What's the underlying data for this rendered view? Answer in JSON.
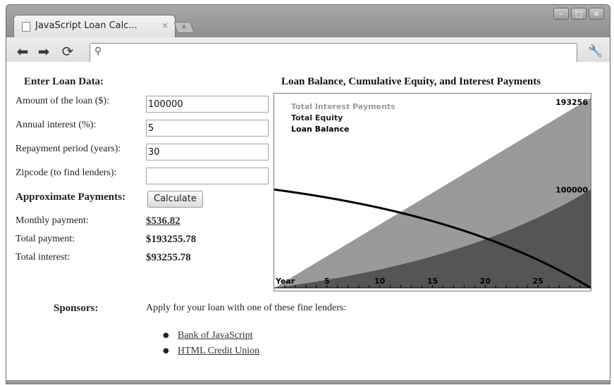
{
  "browser": {
    "tab_title": "JavaScript Loan Calc...",
    "tab_close": "×",
    "new_tab": "+",
    "window_buttons": [
      "–",
      "□",
      "×"
    ],
    "address": "",
    "icons": [
      "back-arrow-icon",
      "forward-arrow-icon",
      "reload-icon",
      "search-icon",
      "wrench-icon",
      "page-icon"
    ]
  },
  "form": {
    "heading": "Enter Loan Data:",
    "amount_label": "Amount of the loan ($):",
    "amount_value": "100000",
    "interest_label": "Annual interest (%):",
    "interest_value": "5",
    "period_label": "Repayment period (years):",
    "period_value": "30",
    "zip_label": "Zipcode (to find lenders):",
    "zip_value": ""
  },
  "payments": {
    "heading": "Approximate Payments:",
    "calculate_label": "Calculate",
    "monthly_label": "Monthly payment:",
    "monthly_value": "$536.82",
    "total_label": "Total payment:",
    "total_value": "$193255.78",
    "interest_label": "Total interest:",
    "interest_value": "$93255.78"
  },
  "sponsors": {
    "heading": "Sponsors:",
    "intro": "Apply for your loan with one of these fine lenders:",
    "lenders": [
      "Bank of JavaScript",
      "HTML Credit Union"
    ]
  },
  "chart_data": {
    "type": "area",
    "title": "Loan Balance, Cumulative Equity, and Interest Payments",
    "xlabel": "Year",
    "x_ticks": [
      5,
      10,
      15,
      20,
      25
    ],
    "xlim": [
      0,
      30
    ],
    "ylim": [
      0,
      193256
    ],
    "max_label": "193256",
    "principal_label": "100000",
    "principal": 100000,
    "annual_rate_percent": 5,
    "years": 30,
    "total_paid": 193255.78,
    "colors": {
      "interest": "#9a9a9a",
      "equity": "#555555",
      "balance": "#000000"
    },
    "series": [
      {
        "name": "Total Interest Payments",
        "kind": "area-total-payments"
      },
      {
        "name": "Total Equity",
        "kind": "area-equity"
      },
      {
        "name": "Loan Balance",
        "kind": "line-balance"
      }
    ]
  }
}
